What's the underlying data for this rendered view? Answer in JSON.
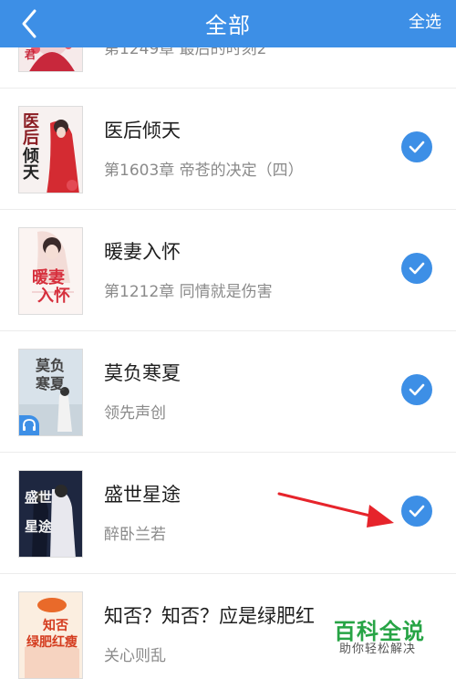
{
  "header": {
    "title": "全部",
    "select_all": "全选",
    "background": "#3d8fe6"
  },
  "books": [
    {
      "title": "",
      "subtitle": "第1249章 最后的时刻2",
      "checked": true,
      "cover": {
        "text": "",
        "bg": "#f6eaea",
        "accent": "#c8283c"
      }
    },
    {
      "title": "医后倾天",
      "subtitle": "第1603章 帝苍的决定（四）",
      "checked": true,
      "cover": {
        "text": "医后倾天",
        "bg": "#f7f1f0",
        "accent": "#d42b32"
      }
    },
    {
      "title": "暖妻入怀",
      "subtitle": "第1212章 同情就是伤害",
      "checked": true,
      "cover": {
        "text": "暖妻入怀",
        "bg": "#fbf4f2",
        "accent": "#d6303d"
      }
    },
    {
      "title": "莫负寒夏",
      "subtitle": "领先声创",
      "checked": true,
      "cover": {
        "text": "莫负寒夏",
        "bg": "#d8e2ea",
        "accent": "#4a4a4a"
      },
      "audio_badge": true
    },
    {
      "title": "盛世星途",
      "subtitle": "醉卧兰若",
      "checked": true,
      "cover": {
        "text": "盛世星途",
        "bg": "#1e2740",
        "accent": "#f4f4f4"
      }
    },
    {
      "title": "知否？知否？应是绿肥红",
      "subtitle": "关心则乱",
      "checked": true,
      "cover": {
        "text": "知否绿肥红瘦",
        "bg": "#fbeee0",
        "accent": "#d43b1e"
      }
    }
  ],
  "watermark": {
    "main": "百科全说",
    "sub": "助你轻松解决",
    "color": "#27a445"
  },
  "arrow_color": "#e6242b",
  "check_color": "#3d8fe6"
}
